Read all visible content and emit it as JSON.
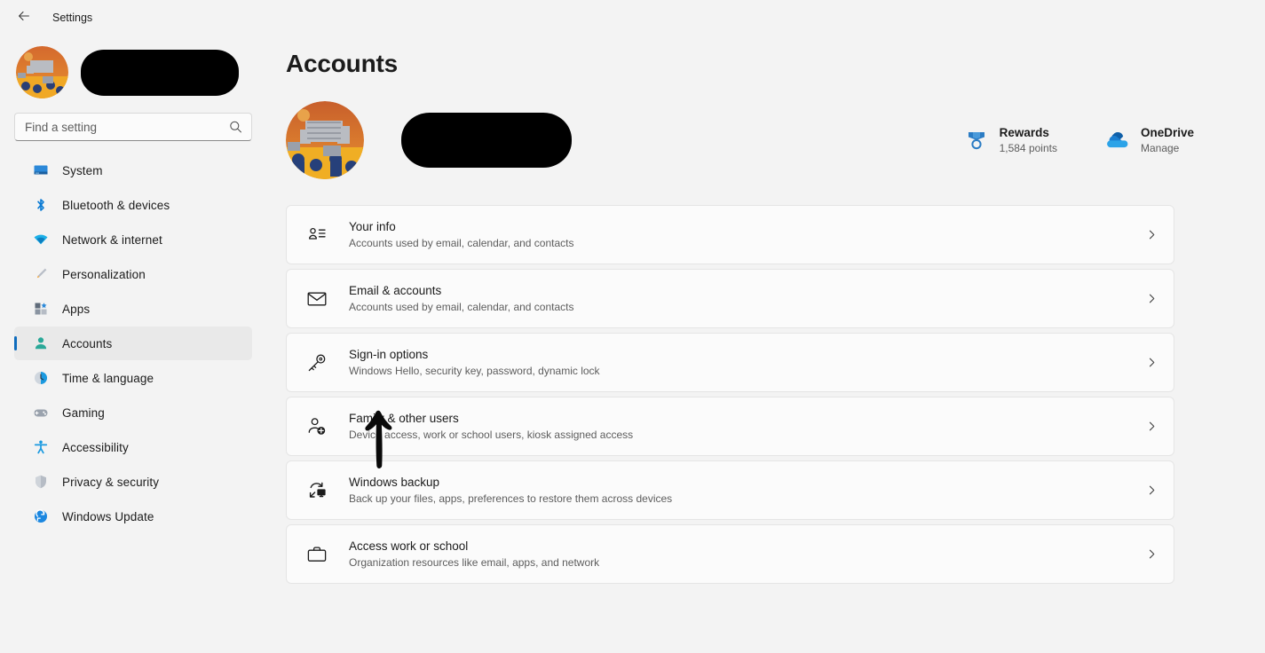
{
  "titlebar": {
    "back_icon": "arrow-left-icon",
    "title": "Settings"
  },
  "sidebar": {
    "profile": {
      "avatar_icon": "user-avatar-image",
      "name_redacted": ""
    },
    "search": {
      "placeholder": "Find a setting",
      "value": "",
      "icon": "search-icon"
    },
    "items": [
      {
        "label": "System",
        "icon": "system-icon",
        "selected": false
      },
      {
        "label": "Bluetooth & devices",
        "icon": "bluetooth-icon",
        "selected": false
      },
      {
        "label": "Network & internet",
        "icon": "wifi-icon",
        "selected": false
      },
      {
        "label": "Personalization",
        "icon": "paintbrush-icon",
        "selected": false
      },
      {
        "label": "Apps",
        "icon": "apps-icon",
        "selected": false
      },
      {
        "label": "Accounts",
        "icon": "accounts-person-icon",
        "selected": true
      },
      {
        "label": "Time & language",
        "icon": "clock-icon",
        "selected": false
      },
      {
        "label": "Gaming",
        "icon": "gamepad-icon",
        "selected": false
      },
      {
        "label": "Accessibility",
        "icon": "accessibility-icon",
        "selected": false
      },
      {
        "label": "Privacy & security",
        "icon": "shield-icon",
        "selected": false
      },
      {
        "label": "Windows Update",
        "icon": "update-refresh-icon",
        "selected": false
      }
    ]
  },
  "main": {
    "page_title": "Accounts",
    "account_header": {
      "avatar_icon": "user-avatar-image-large",
      "name_redacted": ""
    },
    "widgets": [
      {
        "icon": "rewards-medal-icon",
        "title": "Rewards",
        "subtitle": "1,584 points"
      },
      {
        "icon": "onedrive-cloud-icon",
        "title": "OneDrive",
        "subtitle": "Manage"
      }
    ],
    "cards": [
      {
        "icon": "your-info-icon",
        "title": "Your info",
        "subtitle": "Accounts used by email, calendar, and contacts",
        "chevron": "chevron-right-icon"
      },
      {
        "icon": "envelope-icon",
        "title": "Email & accounts",
        "subtitle": "Accounts used by email, calendar, and contacts",
        "chevron": "chevron-right-icon"
      },
      {
        "icon": "key-icon",
        "title": "Sign-in options",
        "subtitle": "Windows Hello, security key, password, dynamic lock",
        "chevron": "chevron-right-icon"
      },
      {
        "icon": "person-add-icon",
        "title": "Family & other users",
        "subtitle": "Device access, work or school users, kiosk assigned access",
        "chevron": "chevron-right-icon"
      },
      {
        "icon": "backup-restore-icon",
        "title": "Windows backup",
        "subtitle": "Back up your files, apps, preferences to restore them across devices",
        "chevron": "chevron-right-icon"
      },
      {
        "icon": "briefcase-icon",
        "title": "Access work or school",
        "subtitle": "Organization resources like email, apps, and network",
        "chevron": "chevron-right-icon"
      }
    ],
    "annotation": {
      "icon": "hand-drawn-up-arrow-annotation"
    }
  },
  "colors": {
    "accent": "#0f6cbd",
    "page_background": "#f3f3f3",
    "card_background": "#fbfbfb",
    "accounts_icon": "#2aa898",
    "redaction": "#000000"
  }
}
